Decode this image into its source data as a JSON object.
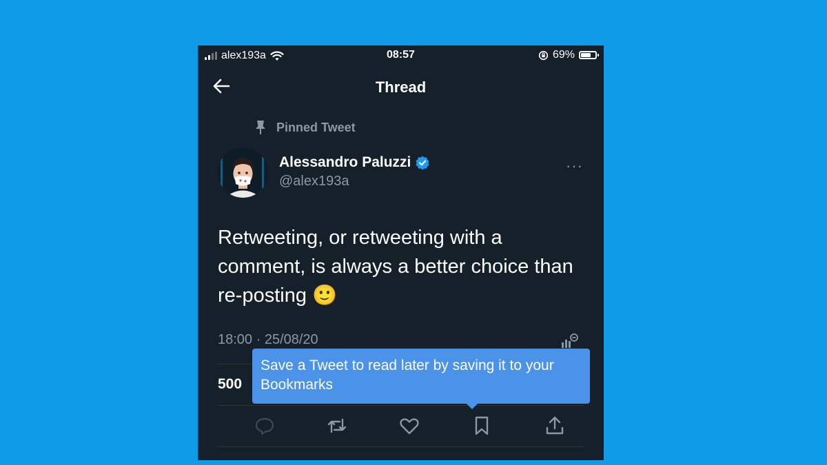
{
  "status_bar": {
    "carrier": "alex193a",
    "time": "08:57",
    "battery_percent": "69%",
    "battery_level": 0.69,
    "icons": [
      "signal-icon",
      "wifi-icon",
      "rotation-lock-icon",
      "battery-icon"
    ]
  },
  "header": {
    "title": "Thread",
    "back_icon": "arrow-left-icon"
  },
  "tweet": {
    "pinned_label": "Pinned Tweet",
    "pinned_icon": "pin-icon",
    "author": {
      "name": "Alessandro Paluzzi",
      "handle": "@alex193a",
      "verified": true
    },
    "text": "Retweeting, or retweeting with a comment, is always a better choice than re-posting 🙂",
    "timestamp": "18:00 · 25/08/20",
    "stat_count": "500",
    "actions": [
      "reply-icon",
      "retweet-icon",
      "like-icon",
      "bookmark-icon",
      "share-icon"
    ]
  },
  "tooltip": {
    "text": "Save a Tweet to read later by saving it to your Bookmarks"
  },
  "colors": {
    "page_background": "#0f9be8",
    "app_background": "#16202a",
    "tooltip_background": "#4a93e8",
    "verified_badge": "#1d9bf0",
    "secondary_text": "#8b98a5"
  }
}
